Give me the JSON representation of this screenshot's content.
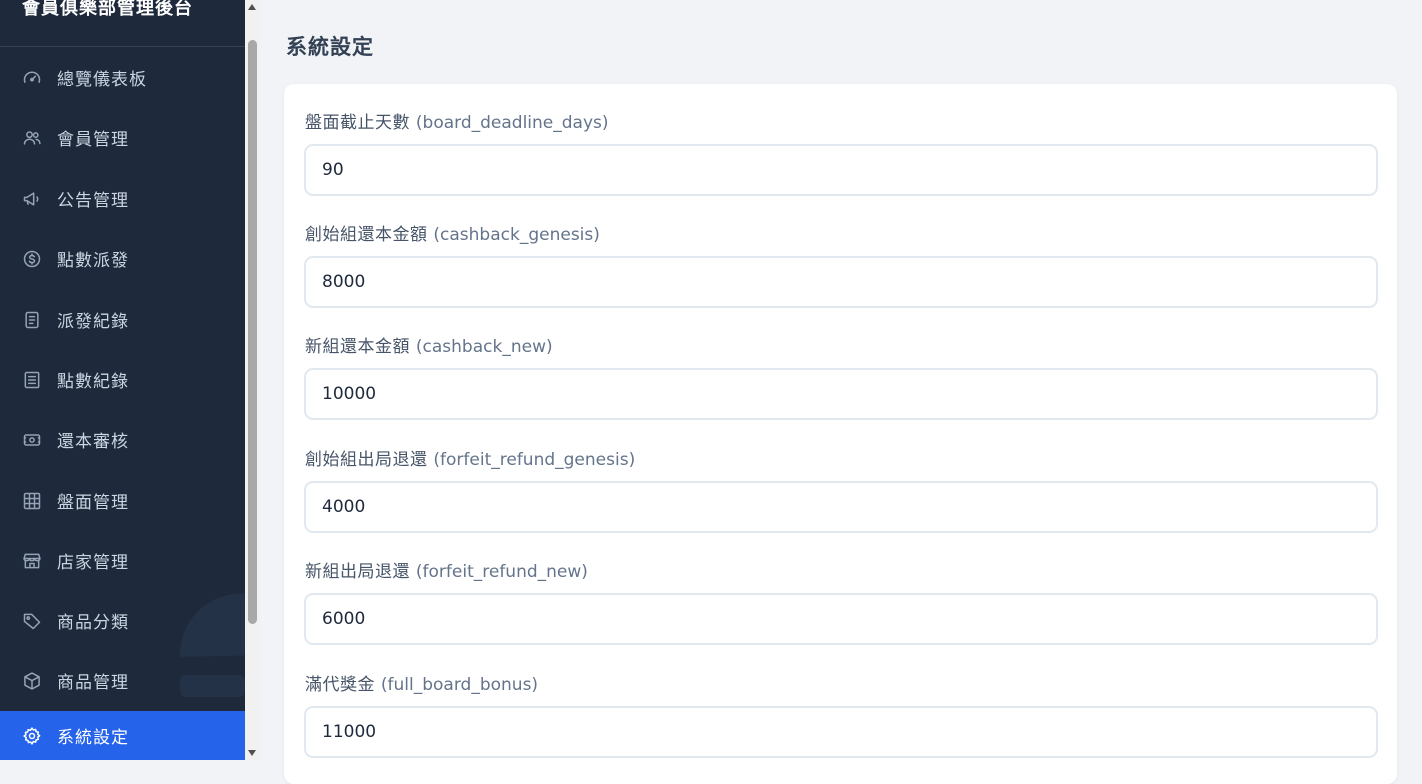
{
  "app": {
    "title": "會員俱樂部管理後台"
  },
  "sidebar": {
    "items": [
      {
        "label": "總覽儀表板",
        "icon": "gauge-icon"
      },
      {
        "label": "會員管理",
        "icon": "users-icon"
      },
      {
        "label": "公告管理",
        "icon": "megaphone-icon"
      },
      {
        "label": "點數派發",
        "icon": "dollar-circle-icon"
      },
      {
        "label": "派發紀錄",
        "icon": "receipt-icon"
      },
      {
        "label": "點數紀錄",
        "icon": "list-icon"
      },
      {
        "label": "還本審核",
        "icon": "cash-icon"
      },
      {
        "label": "盤面管理",
        "icon": "grid-icon"
      },
      {
        "label": "店家管理",
        "icon": "store-icon"
      },
      {
        "label": "商品分類",
        "icon": "tag-icon"
      },
      {
        "label": "商品管理",
        "icon": "box-icon"
      },
      {
        "label": "系統設定",
        "icon": "gear-icon",
        "active": true
      }
    ]
  },
  "main": {
    "title": "系統設定",
    "fields": [
      {
        "label": "盤面截止天數",
        "key": "(board_deadline_days)",
        "value": "90"
      },
      {
        "label": "創始組還本金額",
        "key": "(cashback_genesis)",
        "value": "8000"
      },
      {
        "label": "新組還本金額",
        "key": "(cashback_new)",
        "value": "10000"
      },
      {
        "label": "創始組出局退還",
        "key": "(forfeit_refund_genesis)",
        "value": "4000"
      },
      {
        "label": "新組出局退還",
        "key": "(forfeit_refund_new)",
        "value": "6000"
      },
      {
        "label": "滿代獎金",
        "key": "(full_board_bonus)",
        "value": "11000"
      }
    ]
  },
  "colors": {
    "sidebar_bg": "#1e293b",
    "active_bg": "#2563eb",
    "page_bg": "#f1f3f7"
  }
}
